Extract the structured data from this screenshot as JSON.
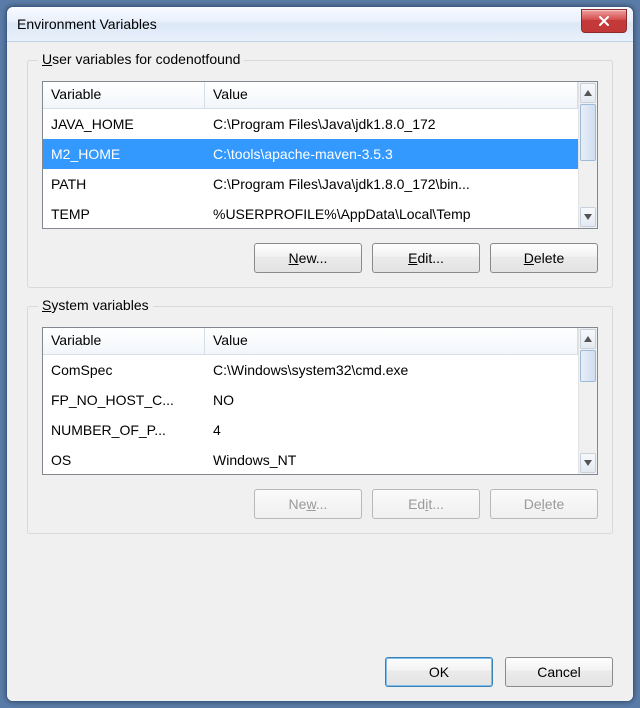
{
  "window": {
    "title": "Environment Variables"
  },
  "userGroup": {
    "label_prefix_u": "U",
    "label_rest": "ser variables for codenotfound",
    "columns": [
      "Variable",
      "Value"
    ],
    "rows": [
      {
        "name": "JAVA_HOME",
        "value": "C:\\Program Files\\Java\\jdk1.8.0_172",
        "selected": false
      },
      {
        "name": "M2_HOME",
        "value": "C:\\tools\\apache-maven-3.5.3",
        "selected": true
      },
      {
        "name": "PATH",
        "value": "C:\\Program Files\\Java\\jdk1.8.0_172\\bin...",
        "selected": false
      },
      {
        "name": "TEMP",
        "value": "%USERPROFILE%\\AppData\\Local\\Temp",
        "selected": false
      }
    ],
    "buttons": {
      "new": {
        "u": "N",
        "rest": "ew...",
        "enabled": true
      },
      "edit": {
        "u": "E",
        "rest": "dit...",
        "enabled": true
      },
      "delete": {
        "u": "D",
        "rest": "elete",
        "enabled": true
      }
    }
  },
  "systemGroup": {
    "label_prefix_u": "S",
    "label_rest": "ystem variables",
    "columns": [
      "Variable",
      "Value"
    ],
    "rows": [
      {
        "name": "ComSpec",
        "value": "C:\\Windows\\system32\\cmd.exe",
        "selected": false
      },
      {
        "name": "FP_NO_HOST_C...",
        "value": "NO",
        "selected": false
      },
      {
        "name": "NUMBER_OF_P...",
        "value": "4",
        "selected": false
      },
      {
        "name": "OS",
        "value": "Windows_NT",
        "selected": false
      }
    ],
    "buttons": {
      "new": {
        "u": "w",
        "pre": "Ne",
        "rest": "...",
        "enabled": false
      },
      "edit": {
        "u": "i",
        "pre": "Ed",
        "rest": "t...",
        "enabled": false
      },
      "delete": {
        "u": "l",
        "pre": "De",
        "rest": "ete",
        "enabled": false
      }
    }
  },
  "footer": {
    "ok": "OK",
    "cancel": "Cancel"
  }
}
